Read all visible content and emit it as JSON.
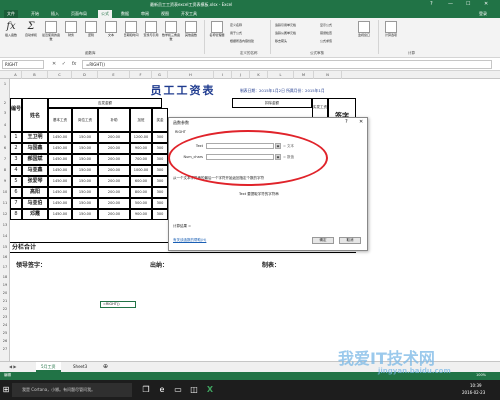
{
  "window": {
    "title": "最新员工工资表excel工资表模板.xlsx - Excel",
    "controls": [
      "?",
      "—",
      "☐",
      "✕"
    ]
  },
  "menu": {
    "tabs": [
      "文件",
      "开始",
      "插入",
      "页面布局",
      "公式",
      "数据",
      "审阅",
      "视图",
      "开发工具"
    ],
    "active": "公式",
    "signin": "登录"
  },
  "ribbon": {
    "buttons": [
      {
        "label": "插入函数"
      },
      {
        "label": "自动求和"
      },
      {
        "label": "最近使用的函数"
      },
      {
        "label": "财务"
      },
      {
        "label": "逻辑"
      },
      {
        "label": "文本"
      },
      {
        "label": "日期和时间"
      },
      {
        "label": "查找与引用"
      },
      {
        "label": "数学和三角函数"
      },
      {
        "label": "其他函数"
      },
      {
        "label": "名称管理器"
      }
    ],
    "small": [
      "定义名称",
      "用于公式",
      "根据所选内容创建",
      "追踪引用单元格",
      "追踪从属单元格",
      "移去箭头",
      "显示公式",
      "错误检查",
      "公式求值",
      "监视窗口",
      "计算选项"
    ],
    "groups": [
      "函数库",
      "定义的名称",
      "公式审核",
      "计算"
    ]
  },
  "formula_bar": {
    "name_box": "RIGHT",
    "buttons": [
      "✕",
      "✓",
      "fx"
    ],
    "formula": "=RIGHT()"
  },
  "columns": [
    "A",
    "B",
    "C",
    "D",
    "E",
    "F",
    "G",
    "H",
    "I",
    "J",
    "K",
    "L",
    "M",
    "N"
  ],
  "rows": [
    "1",
    "2",
    "3",
    "4",
    "5",
    "6",
    "7",
    "8",
    "9",
    "10",
    "11",
    "12",
    "13",
    "14",
    "15",
    "16",
    "17",
    "18",
    "19",
    "20",
    "21",
    "22",
    "23",
    "24",
    "25",
    "26",
    "27"
  ],
  "sheet": {
    "title": "员工工资表",
    "date": "制表日期：2015年1月2日   所属月份：2015年1月",
    "headers": {
      "no": "编号",
      "name": "姓名",
      "pay_group": "应发金额",
      "deduct_group": "扣除金额",
      "base": "基本工资",
      "post": "岗位工资",
      "bonus": "补助",
      "overtime": "加班",
      "award": "奖金",
      "actual": "实发工资",
      "sign": "签字"
    },
    "employees": [
      {
        "id": "1",
        "name": "王卫明",
        "base": "1450.00",
        "post": "150.00",
        "bonus": "200.00",
        "overtime": "1200.00",
        "award": "300"
      },
      {
        "id": "2",
        "name": "马国鑫",
        "base": "1450.00",
        "post": "150.00",
        "bonus": "200.00",
        "overtime": "900.00",
        "award": "300"
      },
      {
        "id": "3",
        "name": "郝国斌",
        "base": "1450.00",
        "post": "150.00",
        "bonus": "200.00",
        "overtime": "700.00",
        "award": "300"
      },
      {
        "id": "4",
        "name": "马亚鑫",
        "base": "1450.00",
        "post": "150.00",
        "bonus": "200.00",
        "overtime": "1000.00",
        "award": "300"
      },
      {
        "id": "5",
        "name": "张爱琴",
        "base": "1450.00",
        "post": "150.00",
        "bonus": "200.00",
        "overtime": "600.00",
        "award": "300"
      },
      {
        "id": "6",
        "name": "高阳",
        "base": "1450.00",
        "post": "150.00",
        "bonus": "200.00",
        "overtime": "800.00",
        "award": "300"
      },
      {
        "id": "7",
        "name": "马亚伯",
        "base": "1450.00",
        "post": "150.00",
        "bonus": "200.00",
        "overtime": "500.00",
        "award": "300"
      },
      {
        "id": "8",
        "name": "邓霞",
        "base": "1450.00",
        "post": "150.00",
        "bonus": "200.00",
        "overtime": "900.00",
        "award": "300"
      }
    ],
    "subtotal": "分栏合计",
    "sign_leader": "领导签字：",
    "sign_cashier": "出纳：",
    "sign_maker": "制表：",
    "active_cell": "=RIGHT()"
  },
  "dialog": {
    "title": "函数参数",
    "func": "RIGHT",
    "args": [
      {
        "label": "Text",
        "result": "= 文本"
      },
      {
        "label": "Num_chars",
        "result": "= 数值"
      }
    ],
    "description": "从一个文本字符串的最后一个字符开始返回指定个数的字符",
    "arg_help": "Text  要提取字符的字符串",
    "result_label": "计算结果 =",
    "help_link": "有关该函数的帮助(H)",
    "ok": "确定",
    "cancel": "取消"
  },
  "sheet_tabs": [
    "5月工资",
    "Sheet3"
  ],
  "status": {
    "mode": "编辑",
    "zoom": "100%"
  },
  "taskbar": {
    "search": "我是 Cortana，小娜。有问题尽管问我。",
    "time": "10:39",
    "date": "2016-02-23"
  },
  "watermark": {
    "line1": "我爱IT技术网",
    "line2": "jingyan.baidu.com"
  },
  "colors": {
    "excel_green": "#217346",
    "highlight_red": "#e0232a",
    "title_blue": "#1f3b8f"
  }
}
